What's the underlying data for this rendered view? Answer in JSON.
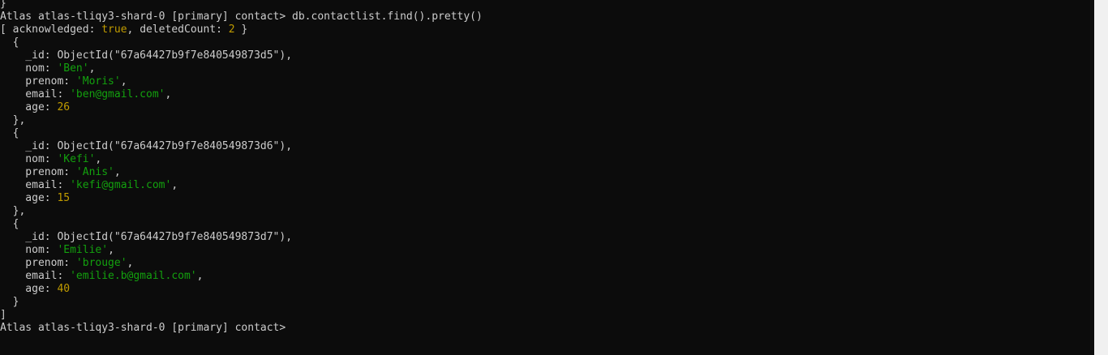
{
  "terminal": {
    "lines": [
      [
        {
          "t": "}"
        }
      ],
      [
        {
          "t": "Atlas atlas-tliqy3-shard-0 [primary] contact> db.contactlist.find().pretty()"
        }
      ],
      [
        {
          "t": "[ acknowledged: "
        },
        {
          "t": "true",
          "c": "kw"
        },
        {
          "t": ", deletedCount: "
        },
        {
          "t": "2",
          "c": "kw"
        },
        {
          "t": " }"
        }
      ],
      [
        {
          "t": "  {"
        }
      ],
      [
        {
          "t": "    _id: ObjectId(\"67a64427b9f7e840549873d5\"),"
        }
      ],
      [
        {
          "t": "    nom: "
        },
        {
          "t": "'Ben'",
          "c": "str"
        },
        {
          "t": ","
        }
      ],
      [
        {
          "t": "    prenom: "
        },
        {
          "t": "'Moris'",
          "c": "str"
        },
        {
          "t": ","
        }
      ],
      [
        {
          "t": "    email: "
        },
        {
          "t": "'ben@gmail.com'",
          "c": "str"
        },
        {
          "t": ","
        }
      ],
      [
        {
          "t": "    age: "
        },
        {
          "t": "26",
          "c": "kw"
        }
      ],
      [
        {
          "t": "  },"
        }
      ],
      [
        {
          "t": "  {"
        }
      ],
      [
        {
          "t": "    _id: ObjectId(\"67a64427b9f7e840549873d6\"),"
        }
      ],
      [
        {
          "t": "    nom: "
        },
        {
          "t": "'Kefi'",
          "c": "str"
        },
        {
          "t": ","
        }
      ],
      [
        {
          "t": "    prenom: "
        },
        {
          "t": "'Anis'",
          "c": "str"
        },
        {
          "t": ","
        }
      ],
      [
        {
          "t": "    email: "
        },
        {
          "t": "'kefi@gmail.com'",
          "c": "str"
        },
        {
          "t": ","
        }
      ],
      [
        {
          "t": "    age: "
        },
        {
          "t": "15",
          "c": "kw"
        }
      ],
      [
        {
          "t": "  },"
        }
      ],
      [
        {
          "t": "  {"
        }
      ],
      [
        {
          "t": "    _id: ObjectId(\"67a64427b9f7e840549873d7\"),"
        }
      ],
      [
        {
          "t": "    nom: "
        },
        {
          "t": "'Emilie'",
          "c": "str"
        },
        {
          "t": ","
        }
      ],
      [
        {
          "t": "    prenom: "
        },
        {
          "t": "'brouge'",
          "c": "str"
        },
        {
          "t": ","
        }
      ],
      [
        {
          "t": "    email: "
        },
        {
          "t": "'emilie.b@gmail.com'",
          "c": "str"
        },
        {
          "t": ","
        }
      ],
      [
        {
          "t": "    age: "
        },
        {
          "t": "40",
          "c": "kw"
        }
      ],
      [
        {
          "t": "  }"
        }
      ],
      [
        {
          "t": "]"
        }
      ],
      [
        {
          "t": "Atlas atlas-tliqy3-shard-0 [primary] contact>"
        }
      ]
    ]
  },
  "colors": {
    "background": "#0c0c0c",
    "text": "#cccccc",
    "keyword": "#c19c00",
    "string": "#13a10e",
    "scrollbar": "#f0f0f0"
  }
}
